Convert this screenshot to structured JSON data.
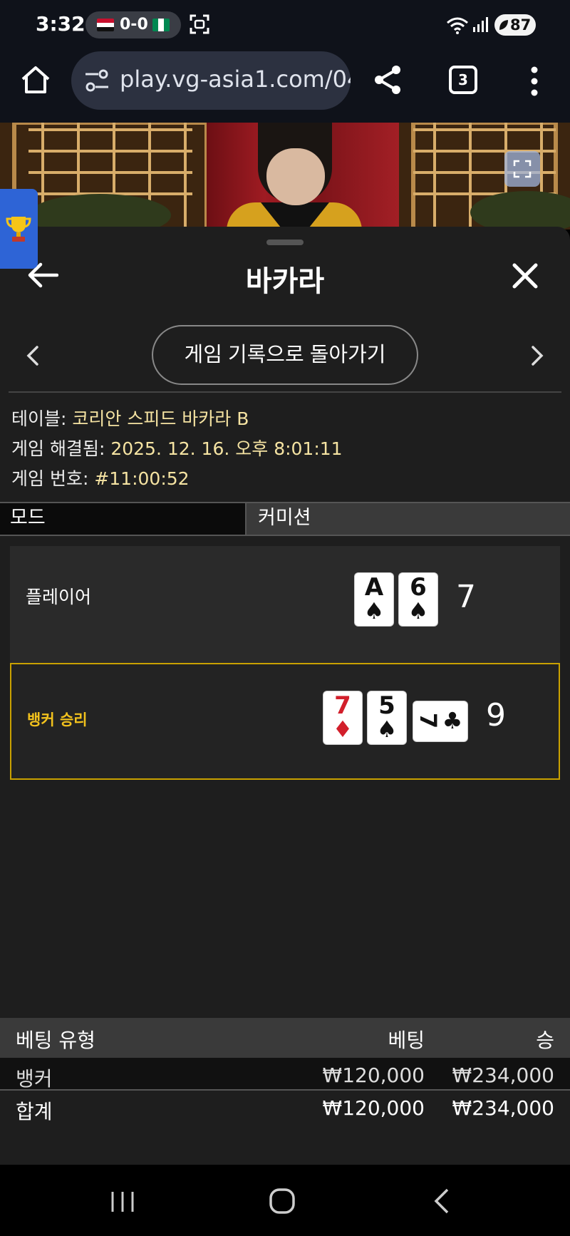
{
  "status_bar": {
    "time": "3:32",
    "score": "0-0",
    "battery": "87",
    "icons": [
      "egypt-flag",
      "nigeria-flag",
      "screenshot-icon",
      "wifi-icon",
      "signal-icon",
      "battery-saver-icon"
    ]
  },
  "browser": {
    "url": "play.vg-asia1.com/04",
    "tab_count": "3",
    "icons": [
      "home-icon",
      "site-settings-icon",
      "share-icon",
      "tabs-icon",
      "more-icon"
    ]
  },
  "panel": {
    "title": "바카라",
    "history_button": "게임 기록으로 돌아가기",
    "info": {
      "table_label": "테이블:",
      "table_value": "코리안 스피드 바카라 B",
      "resolved_label": "게임 해결됨:",
      "resolved_value": "2025. 12. 16. 오후 8:01:11",
      "round_label": "게임 번호:",
      "round_value": "#11:00:52"
    },
    "mode": {
      "label": "모드",
      "value": "커미션"
    },
    "player": {
      "label": "플레이어",
      "total": "7",
      "cards": [
        {
          "rank": "A",
          "suit": "♠"
        },
        {
          "rank": "6",
          "suit": "♠"
        }
      ]
    },
    "banker": {
      "label": "뱅커 승리",
      "total": "9",
      "cards": [
        {
          "rank": "7",
          "suit": "♦"
        },
        {
          "rank": "5",
          "suit": "♠"
        },
        {
          "rank": "7",
          "suit": "♣"
        }
      ]
    },
    "bets": {
      "headers": {
        "type": "베팅 유형",
        "bet": "베팅",
        "win": "승"
      },
      "rows": [
        {
          "type": "뱅커",
          "bet": "₩120,000",
          "win": "₩234,000"
        }
      ],
      "total": {
        "type": "합계",
        "bet": "₩120,000",
        "win": "₩234,000"
      }
    }
  },
  "colors": {
    "panel_bg": "#1e1e1e",
    "winner_border": "#c9a100",
    "winner_text": "#f2c21d",
    "info_value": "#f5e3a2",
    "trophy_tab": "#2e64d6"
  }
}
